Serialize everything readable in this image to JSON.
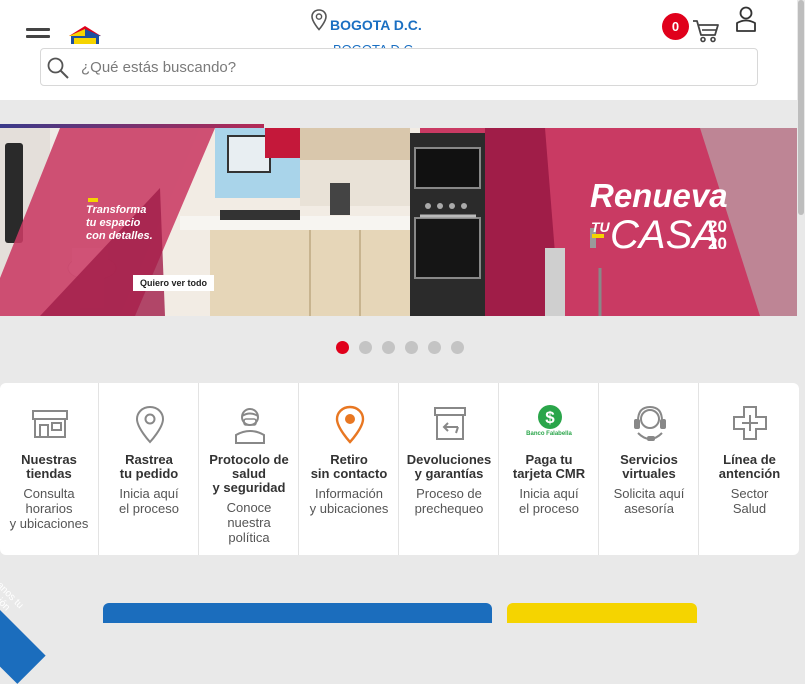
{
  "header": {
    "location_primary": "BOGOTA D.C.",
    "location_secondary": "BOGOTA D.C.",
    "cart_count": "0",
    "search_placeholder": "¿Qué estás buscando?"
  },
  "banner": {
    "left_text": [
      "Transforma",
      "tu espacio",
      "con detalles."
    ],
    "button_label": "Quiero ver todo",
    "headline": "Renueva",
    "sub_small": "TU",
    "sub_big": "CASA",
    "year_top": "20",
    "year_bottom": "20",
    "colors": {
      "magenta": "#c93a63",
      "dark_magenta": "#a01d48"
    }
  },
  "carousel": {
    "total": 6,
    "active": 0
  },
  "services": [
    {
      "title": [
        "Nuestras",
        "tiendas"
      ],
      "desc": [
        "Consulta",
        "horarios",
        "y ubicaciones"
      ],
      "icon": "store-icon"
    },
    {
      "title": [
        "Rastrea",
        "tu pedido"
      ],
      "desc": [
        "Inicia aquí",
        "el proceso"
      ],
      "icon": "location-pin-icon"
    },
    {
      "title": [
        "Protocolo de",
        "salud",
        "y seguridad"
      ],
      "desc": [
        "Conoce",
        "nuestra",
        "política"
      ],
      "icon": "health-worker-icon"
    },
    {
      "title": [
        "Retiro",
        "sin contacto"
      ],
      "desc": [
        "Información",
        "y ubicaciones"
      ],
      "icon": "pickup-pin-icon"
    },
    {
      "title": [
        "Devoluciones",
        "y garantías"
      ],
      "desc": [
        "Proceso de",
        "prechequeo"
      ],
      "icon": "returns-box-icon"
    },
    {
      "title": [
        "Paga tu",
        "tarjeta CMR"
      ],
      "desc": [
        "Inicia aquí",
        "el proceso"
      ],
      "icon": "banco-falabella-icon",
      "icon_label": "Banco Falabella"
    },
    {
      "title": [
        "Servicios",
        "virtuales"
      ],
      "desc": [
        "Solicita aquí",
        "asesoría"
      ],
      "icon": "headset-icon"
    },
    {
      "title": [
        "Línea de",
        "antención"
      ],
      "desc": [
        "Sector",
        "Salud"
      ],
      "icon": "medical-cross-icon"
    }
  ],
  "feedback": {
    "label": [
      "Danos tu",
      "opinión"
    ]
  },
  "colors": {
    "brand_red": "#e0001b",
    "link_blue": "#1a6fc2",
    "cmr_green": "#2aa54a",
    "accent_orange": "#e87722"
  }
}
